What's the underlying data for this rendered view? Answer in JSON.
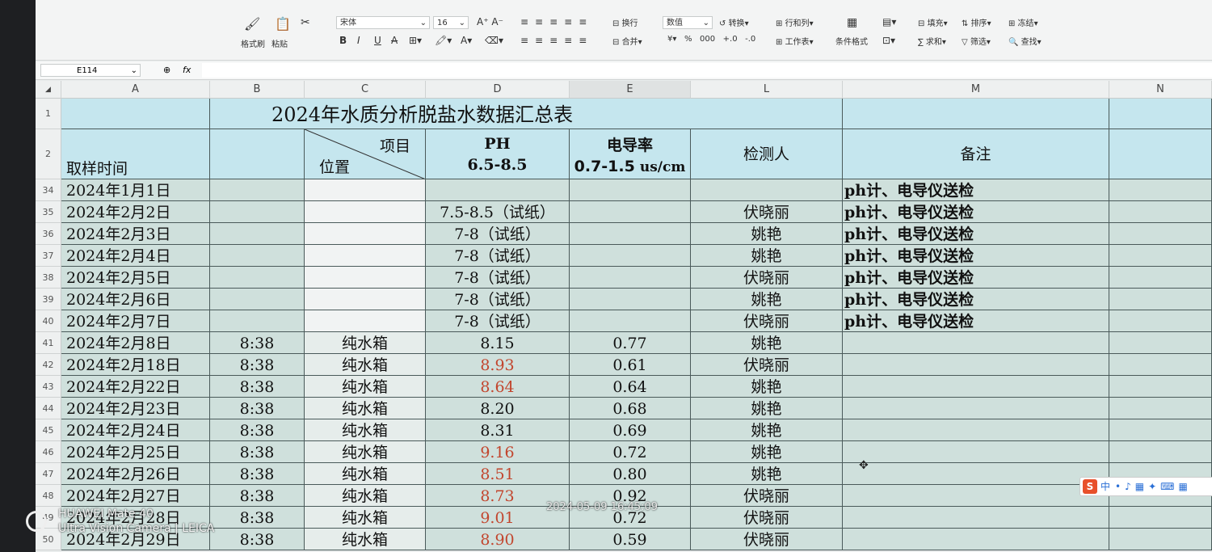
{
  "toolbar": {
    "clipboard": [
      "格式刷",
      "粘贴"
    ],
    "font_name": "宋体",
    "font_size": "16",
    "wrap": "换行",
    "merge": "合并",
    "number_format": "数值",
    "convert": "转换",
    "rows_cols": "行和列",
    "worksheet": "工作表",
    "cond_format": "条件格式",
    "fill": "填充",
    "sort": "排序",
    "freeze": "冻结",
    "sum": "求和",
    "filter": "筛选",
    "find": "查找",
    "number_symbols": [
      "¥",
      "%",
      "000",
      "+.0",
      "-.0"
    ]
  },
  "formula_bar": {
    "name_box": "E114",
    "fx": "fx"
  },
  "columns": [
    "A",
    "B",
    "C",
    "D",
    "E",
    "L",
    "M",
    "N"
  ],
  "sheet": {
    "title": "2024年水质分析脱盐水数据汇总表",
    "header": {
      "time": "取样时间",
      "item": "项目",
      "location": "位置",
      "ph": "PH",
      "ph_range": "6.5-8.5",
      "cond": "电导率",
      "cond_range": "0.7-1.5",
      "cond_unit": "us/cm",
      "inspector": "检测人",
      "remark": "备注"
    },
    "rows": [
      {
        "num": "34",
        "date": "2024年1月1日",
        "time": "",
        "loc": "",
        "ph": "",
        "cond": "",
        "person": "",
        "remark": "ph计、电导仪送检",
        "red": false
      },
      {
        "num": "35",
        "date": "2024年2月2日",
        "time": "",
        "loc": "",
        "ph": "7.5-8.5（试纸）",
        "cond": "",
        "person": "伏晓丽",
        "remark": "ph计、电导仪送检",
        "red": false
      },
      {
        "num": "36",
        "date": "2024年2月3日",
        "time": "",
        "loc": "",
        "ph": "7-8（试纸）",
        "cond": "",
        "person": "姚艳",
        "remark": "ph计、电导仪送检",
        "red": false
      },
      {
        "num": "37",
        "date": "2024年2月4日",
        "time": "",
        "loc": "",
        "ph": "7-8（试纸）",
        "cond": "",
        "person": "姚艳",
        "remark": "ph计、电导仪送检",
        "red": false
      },
      {
        "num": "38",
        "date": "2024年2月5日",
        "time": "",
        "loc": "",
        "ph": "7-8（试纸）",
        "cond": "",
        "person": "伏晓丽",
        "remark": "ph计、电导仪送检",
        "red": false
      },
      {
        "num": "39",
        "date": "2024年2月6日",
        "time": "",
        "loc": "",
        "ph": "7-8（试纸）",
        "cond": "",
        "person": "姚艳",
        "remark": "ph计、电导仪送检",
        "red": false
      },
      {
        "num": "40",
        "date": "2024年2月7日",
        "time": "",
        "loc": "",
        "ph": "7-8（试纸）",
        "cond": "",
        "person": "伏晓丽",
        "remark": "ph计、电导仪送检",
        "red": false
      },
      {
        "num": "41",
        "date": "2024年2月8日",
        "time": "8:38",
        "loc": "纯水箱",
        "ph": "8.15",
        "cond": "0.77",
        "person": "姚艳",
        "remark": "",
        "red": false
      },
      {
        "num": "42",
        "date": "2024年2月18日",
        "time": "8:38",
        "loc": "纯水箱",
        "ph": "8.93",
        "cond": "0.61",
        "person": "伏晓丽",
        "remark": "",
        "red": true
      },
      {
        "num": "43",
        "date": "2024年2月22日",
        "time": "8:38",
        "loc": "纯水箱",
        "ph": "8.64",
        "cond": "0.64",
        "person": "姚艳",
        "remark": "",
        "red": true
      },
      {
        "num": "44",
        "date": "2024年2月23日",
        "time": "8:38",
        "loc": "纯水箱",
        "ph": "8.20",
        "cond": "0.68",
        "person": "姚艳",
        "remark": "",
        "red": false
      },
      {
        "num": "45",
        "date": "2024年2月24日",
        "time": "8:38",
        "loc": "纯水箱",
        "ph": "8.31",
        "cond": "0.69",
        "person": "姚艳",
        "remark": "",
        "red": false
      },
      {
        "num": "46",
        "date": "2024年2月25日",
        "time": "8:38",
        "loc": "纯水箱",
        "ph": "9.16",
        "cond": "0.72",
        "person": "姚艳",
        "remark": "",
        "red": true
      },
      {
        "num": "47",
        "date": "2024年2月26日",
        "time": "8:38",
        "loc": "纯水箱",
        "ph": "8.51",
        "cond": "0.80",
        "person": "姚艳",
        "remark": "",
        "red": true
      },
      {
        "num": "48",
        "date": "2024年2月27日",
        "time": "8:38",
        "loc": "纯水箱",
        "ph": "8.73",
        "cond": "0.92",
        "person": "伏晓丽",
        "remark": "",
        "red": true
      },
      {
        "num": "49",
        "date": "2024年2月28日",
        "time": "8:38",
        "loc": "纯水箱",
        "ph": "9.01",
        "cond": "0.72",
        "person": "伏晓丽",
        "remark": "",
        "red": true
      },
      {
        "num": "50",
        "date": "2024年2月29日",
        "time": "8:38",
        "loc": "纯水箱",
        "ph": "8.90",
        "cond": "0.59",
        "person": "伏晓丽",
        "remark": "",
        "red": true
      }
    ]
  },
  "ime": "中",
  "watermark": {
    "brand": "HUAWEI Mate 40",
    "camera": "Ultra Vision Camera | LEICA",
    "timestamp": "2024-05-09 16:45:09"
  }
}
